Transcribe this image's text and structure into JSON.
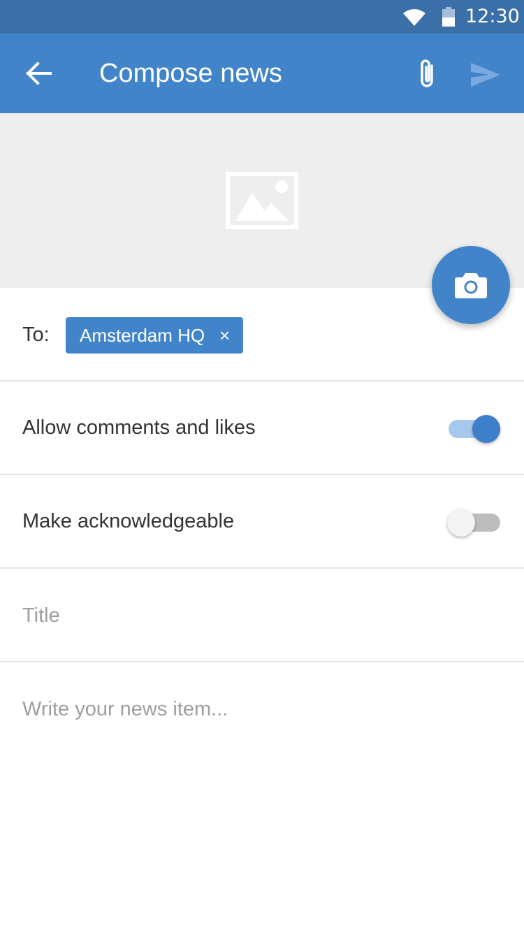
{
  "status_bar": {
    "time": "12:30",
    "icons": [
      "wifi-icon",
      "battery-icon"
    ]
  },
  "app_bar": {
    "title": "Compose news",
    "back_icon": "arrow-left-icon",
    "attach_icon": "paperclip-icon",
    "send_icon": "send-icon",
    "color": "#4284c9"
  },
  "image_area": {
    "placeholder_icon": "image-placeholder-icon",
    "camera_icon": "camera-icon"
  },
  "recipients": {
    "label": "To:",
    "chips": [
      {
        "text": "Amsterdam HQ",
        "close_glyph": "×"
      }
    ]
  },
  "options": {
    "allow_comments": {
      "label": "Allow comments and likes",
      "enabled": true
    },
    "acknowledgeable": {
      "label": "Make acknowledgeable",
      "enabled": false
    }
  },
  "form": {
    "title_placeholder": "Title",
    "body_placeholder": "Write your news item..."
  }
}
